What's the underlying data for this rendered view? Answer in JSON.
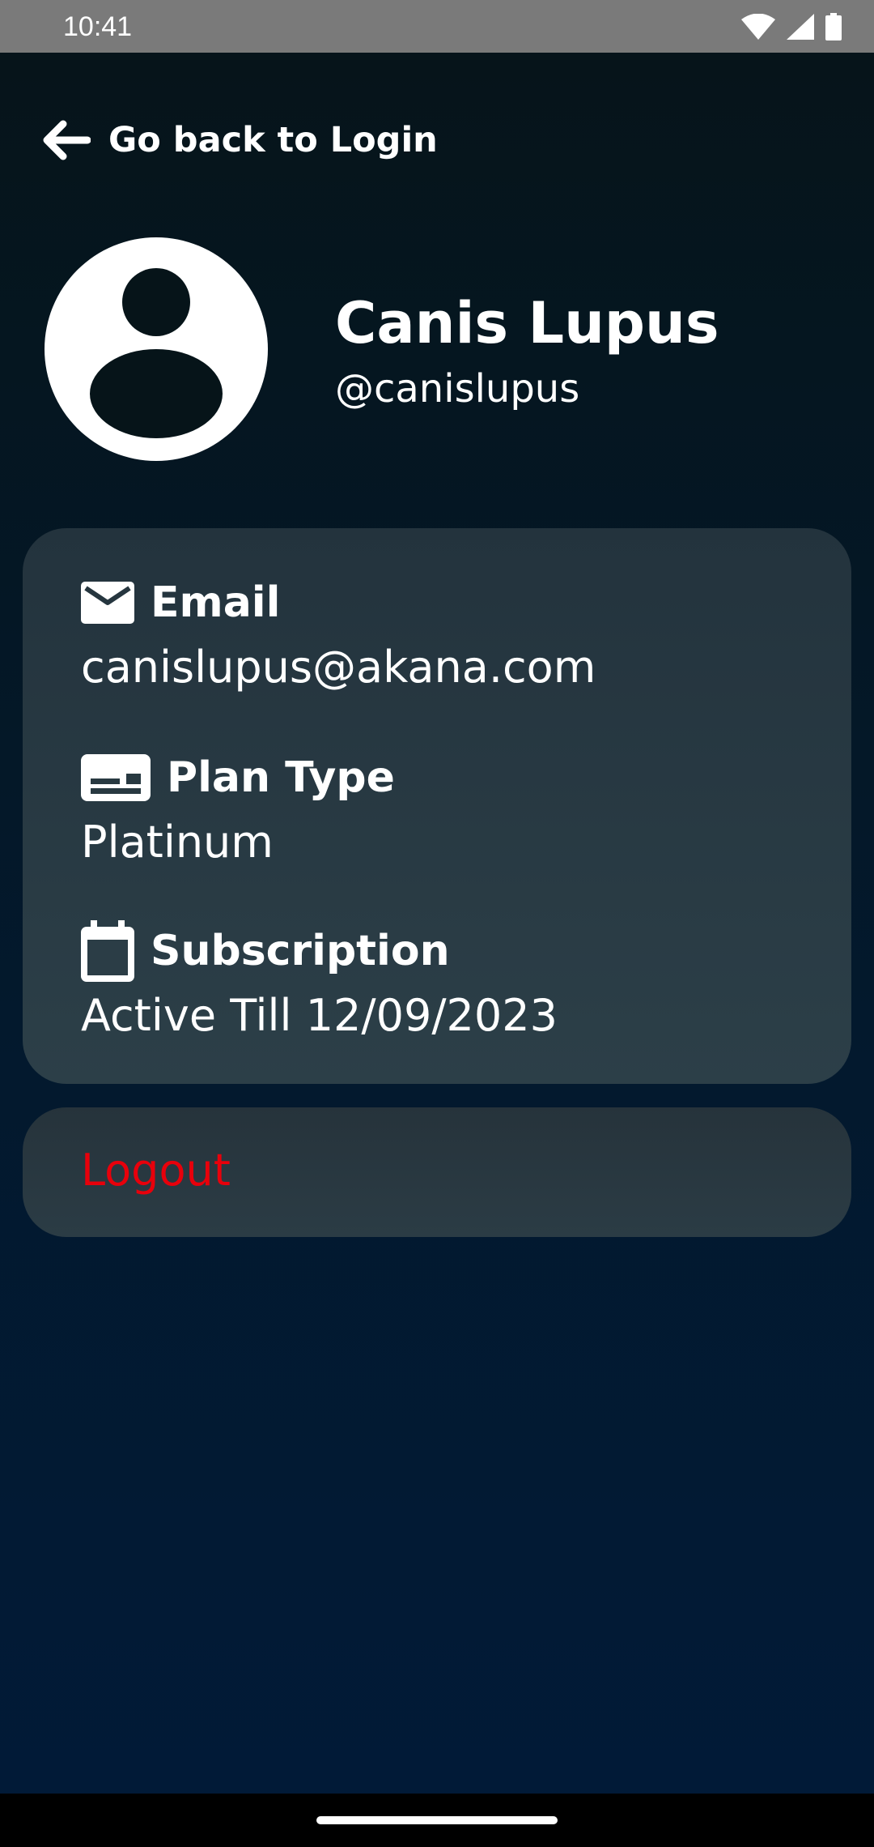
{
  "status_bar": {
    "time": "10:41",
    "icons": [
      "wifi-icon",
      "signal-icon",
      "battery-icon"
    ]
  },
  "back_link": {
    "label": "Go back to Login",
    "icon": "arrow-left-icon"
  },
  "profile": {
    "name": "Canis Lupus",
    "handle": "@canislupus",
    "avatar_icon": "account-circle-icon"
  },
  "info": {
    "email": {
      "title": "Email",
      "value": "canislupus@akana.com",
      "icon": "mail-icon"
    },
    "plan": {
      "title": "Plan Type",
      "value": "Platinum",
      "icon": "card-icon"
    },
    "subscription": {
      "title": "Subscription",
      "value": "Active Till 12/09/2023",
      "icon": "calendar-icon"
    }
  },
  "logout": {
    "label": "Logout"
  },
  "colors": {
    "background_top": "#061419",
    "background_bottom": "#011a38",
    "card": "#2a3c45",
    "logout_text": "#e8000b",
    "text": "#ffffff"
  }
}
